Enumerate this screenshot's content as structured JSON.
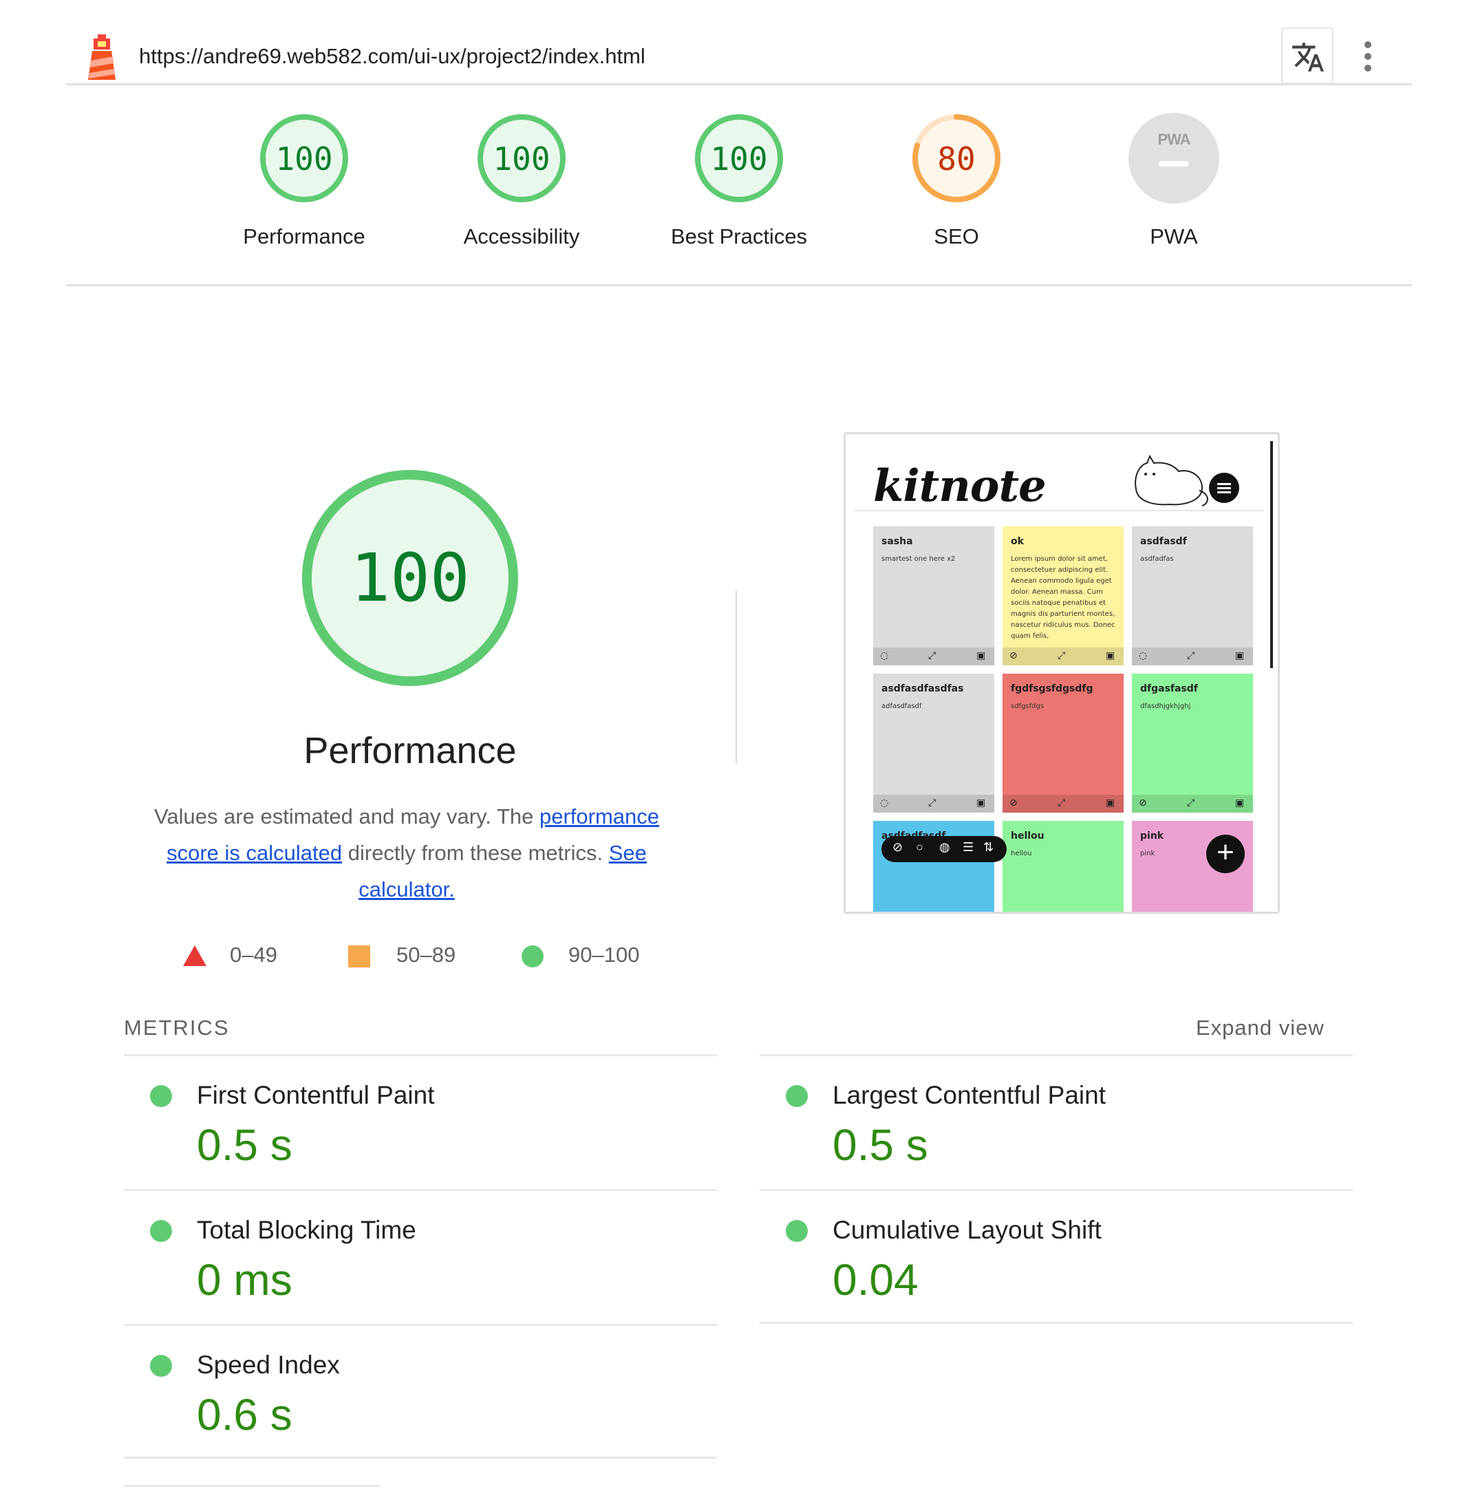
{
  "header": {
    "url": "https://andre69.web582.com/ui-ux/project2/index.html",
    "translate_icon": "translate-icon",
    "menu_icon": "kebab-menu-icon"
  },
  "categories": [
    {
      "score": "100",
      "label": "Performance",
      "fraction": 1.0,
      "color": "#5ecb72",
      "text_color": "#0a7d2b"
    },
    {
      "score": "100",
      "label": "Accessibility",
      "fraction": 1.0,
      "color": "#5ecb72",
      "text_color": "#0a7d2b"
    },
    {
      "score": "100",
      "label": "Best Practices",
      "fraction": 1.0,
      "color": "#5ecb72",
      "text_color": "#0a7d2b"
    },
    {
      "score": "80",
      "label": "SEO",
      "fraction": 0.8,
      "color": "#f6a84b",
      "text_color": "#c33300"
    },
    {
      "score": "PWA",
      "label": "PWA",
      "fraction": 0,
      "color": "#e0e0e0",
      "text_color": "#9e9e9e"
    }
  ],
  "performance": {
    "score": "100",
    "title": "Performance",
    "desc_prefix": "Values are estimated and may vary. The ",
    "link1": "performance score is calculated",
    "desc_mid": " directly from these metrics. ",
    "link2": "See calculator."
  },
  "legend": {
    "fail": "0–49",
    "average": "50–89",
    "pass": "90–100"
  },
  "thumbnail": {
    "brand": "kitnote",
    "notes": [
      {
        "title": "sasha",
        "body": "smartest one here x2",
        "color": "#dcdcdc"
      },
      {
        "title": "ok",
        "body": "Lorem ipsum dolor sit amet, consectetuer adipiscing elit. Aenean commodo ligula eget dolor. Aenean massa. Cum sociis natoque penatibus et magnis dis parturient montes, nascetur ridiculus mus. Donec quam felis,",
        "color": "#fff3a0"
      },
      {
        "title": "asdfasdf",
        "body": "asdfadfas",
        "color": "#dcdcdc"
      },
      {
        "title": "asdfasdfasdfas",
        "body": "adfasdfasdf",
        "color": "#dcdcdc"
      },
      {
        "title": "fgdfsgsfdgsdfg",
        "body": "sdfgsfdgs",
        "color": "#ec7570"
      },
      {
        "title": "dfgasfasdf",
        "body": "dfasdhjgkhjghj",
        "color": "#8ff59c"
      },
      {
        "title": "asdfadfasdf",
        "body": "",
        "color": "#57c3ea"
      },
      {
        "title": "hellou",
        "body": "hellou",
        "color": "#8ff59c"
      },
      {
        "title": "pink",
        "body": "pink",
        "color": "#eba1d0"
      }
    ]
  },
  "metrics": {
    "title": "METRICS",
    "expand_label": "Expand view",
    "items": [
      {
        "name": "First Contentful Paint",
        "value": "0.5 s"
      },
      {
        "name": "Largest Contentful Paint",
        "value": "0.5 s"
      },
      {
        "name": "Total Blocking Time",
        "value": "0 ms"
      },
      {
        "name": "Cumulative Layout Shift",
        "value": "0.04"
      },
      {
        "name": "Speed Index",
        "value": "0.6 s"
      }
    ]
  }
}
